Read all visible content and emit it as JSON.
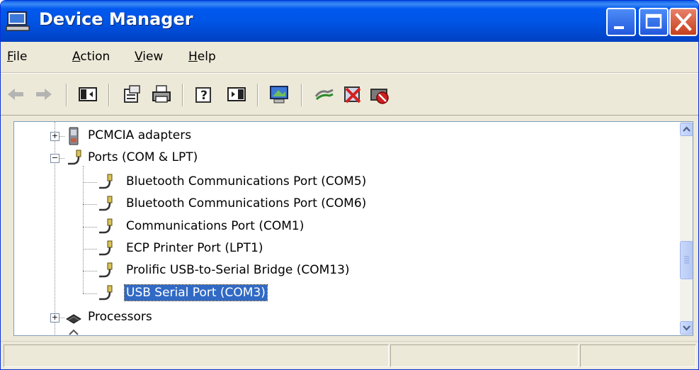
{
  "window": {
    "title": "Device Manager"
  },
  "menu": [
    {
      "label": "File",
      "underline": "F",
      "rest": "ile"
    },
    {
      "label": "Action",
      "underline": "A",
      "rest": "ction"
    },
    {
      "label": "View",
      "underline": "V",
      "rest": "iew"
    },
    {
      "label": "Help",
      "underline": "H",
      "rest": "elp"
    }
  ],
  "toolbar": {
    "buttons": [
      "back-arrow-icon",
      "forward-arrow-icon",
      "show-hide-console-tree-icon",
      "properties-icon",
      "print-icon",
      "help-icon",
      "show-hide-action-pane-icon",
      "scan-hardware-icon",
      "update-driver-icon",
      "uninstall-icon",
      "disable-icon"
    ]
  },
  "tree": {
    "items": [
      {
        "label": "PCMCIA adapters",
        "expander": "+"
      },
      {
        "label": "Ports (COM & LPT)",
        "expander": "−"
      },
      {
        "label": "Bluetooth Communications Port (COM5)"
      },
      {
        "label": "Bluetooth Communications Port (COM6)"
      },
      {
        "label": "Communications Port (COM1)"
      },
      {
        "label": "ECP Printer Port (LPT1)"
      },
      {
        "label": "Prolific USB-to-Serial Bridge (COM13)"
      },
      {
        "label": "USB Serial Port (COM3)",
        "selected": true
      },
      {
        "label": "Processors",
        "expander": "+"
      }
    ]
  },
  "colors": {
    "titlebar": "#0055e5",
    "selection": "#316ac5",
    "window_bg": "#ece9d8"
  }
}
